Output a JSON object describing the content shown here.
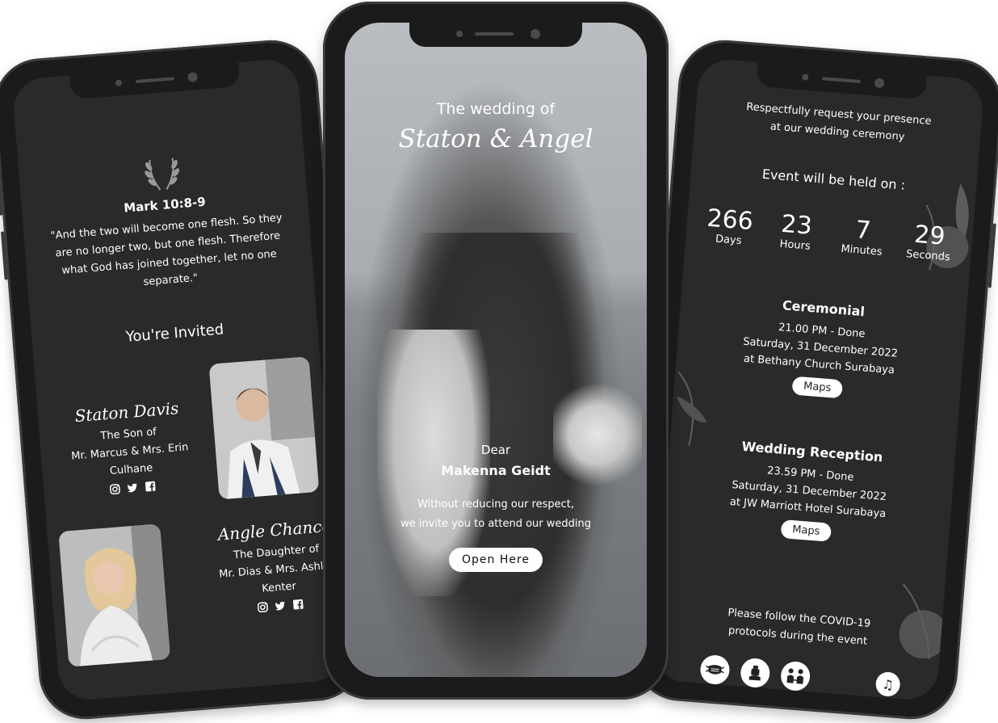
{
  "left": {
    "verse_ref": "Mark 10:8-9",
    "verse_text": "\"And the two will become one flesh. So they are no longer two, but one flesh. Therefore what God has joined together, let no one separate.\"",
    "invited": "You're Invited",
    "groom": {
      "name": "Staton Davis",
      "relation": "The Son of",
      "parents": "Mr. Marcus & Mrs. Erin Culhane"
    },
    "bride": {
      "name": "Angle Chance",
      "relation": "The Daughter of",
      "parents": "Mr. Dias & Mrs. Ashlyn Kenter"
    }
  },
  "center": {
    "title_small": "The wedding of",
    "title_big": "Staton & Angel",
    "dear": "Dear",
    "guest_name": "Makenna Geidt",
    "message_line1": "Without reducing our respect,",
    "message_line2": "we invite you to attend our wedding",
    "open_button": "Open Here"
  },
  "right": {
    "request_line1": "Respectfully request your presence",
    "request_line2": "at our wedding ceremony",
    "event_label": "Event will be held on :",
    "countdown": [
      {
        "value": "266",
        "label": "Days"
      },
      {
        "value": "23",
        "label": "Hours"
      },
      {
        "value": "7",
        "label": "Minutes"
      },
      {
        "value": "29",
        "label": "Seconds"
      }
    ],
    "ceremonial": {
      "title": "Ceremonial",
      "time": "21.00 PM - Done",
      "date": "Saturday, 31 December 2022",
      "place": "at Bethany Church Surabaya",
      "maps": "Maps"
    },
    "reception": {
      "title": "Wedding Reception",
      "time": "23.59 PM - Done",
      "date": "Saturday, 31 December 2022",
      "place": "at JW Marriott Hotel Surabaya",
      "maps": "Maps"
    },
    "covid_line1": "Please follow the COVID-19",
    "covid_line2": "protocols during the event",
    "covid_icons": [
      "mask-icon",
      "hand-wash-icon",
      "distance-icon"
    ],
    "music_icon": "music-note-icon"
  },
  "colors": {
    "screen_bg": "#2a2a2a",
    "frame": "#1b1b1b",
    "text": "#ffffff",
    "button_bg": "#ffffff"
  }
}
